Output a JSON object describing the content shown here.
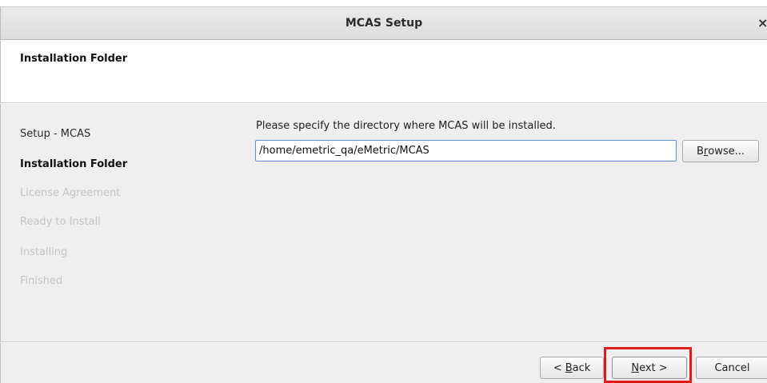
{
  "window": {
    "title": "MCAS Setup",
    "close_glyph": "×"
  },
  "header": {
    "title": "Installation Folder"
  },
  "steps": [
    {
      "label": "Setup - MCAS",
      "state": "done"
    },
    {
      "label": "Installation Folder",
      "state": "current"
    },
    {
      "label": "License Agreement",
      "state": "pending"
    },
    {
      "label": "Ready to Install",
      "state": "pending"
    },
    {
      "label": "Installing",
      "state": "pending"
    },
    {
      "label": "Finished",
      "state": "pending"
    }
  ],
  "main": {
    "prompt": "Please specify the directory where MCAS will be installed.",
    "path_value": "/home/emetric_qa/eMetric/MCAS",
    "browse_prefix": "B",
    "browse_mnemonic": "r",
    "browse_suffix": "owse..."
  },
  "footer": {
    "back_prefix": "< ",
    "back_mnemonic": "B",
    "back_suffix": "ack",
    "next_mnemonic": "N",
    "next_suffix": "ext >",
    "cancel_label": "Cancel"
  },
  "colors": {
    "highlight": "#e01b1b",
    "input_focus": "#5b8fd6",
    "pending_text": "#c4c4c4"
  }
}
